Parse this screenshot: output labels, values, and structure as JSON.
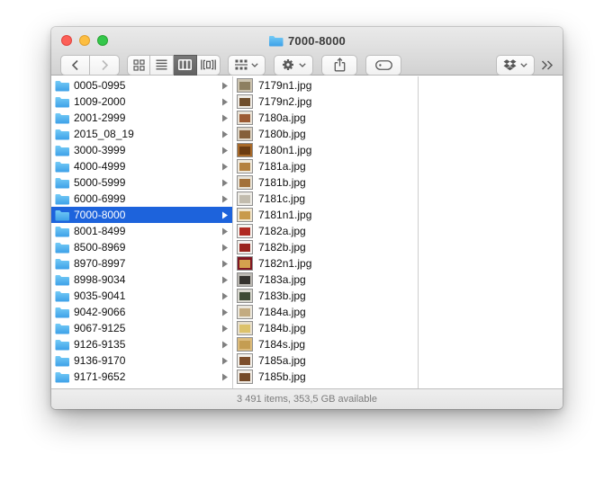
{
  "window": {
    "title": "7000-8000",
    "traffic_lights": [
      "close",
      "minimize",
      "zoom"
    ]
  },
  "toolbar": {
    "view_mode_selected": "column",
    "icons": {
      "back": "chevron-left-icon",
      "forward": "chevron-right-icon",
      "icon_view": "grid-icon",
      "list_view": "list-lines-icon",
      "column_view": "columns-icon",
      "cover_flow": "coverflow-icon",
      "arrange": "arrange-grid-icon",
      "action": "gear-icon",
      "share": "share-icon",
      "tags": "tag-icon",
      "dropbox": "dropbox-icon",
      "overflow": "double-chevron-right-icon"
    }
  },
  "columns": {
    "folders": {
      "selected_index": 8,
      "items": [
        {
          "name": "0005-0995",
          "selected": false
        },
        {
          "name": "1009-2000",
          "selected": false
        },
        {
          "name": "2001-2999",
          "selected": false
        },
        {
          "name": "2015_08_19",
          "selected": false
        },
        {
          "name": "3000-3999",
          "selected": false
        },
        {
          "name": "4000-4999",
          "selected": false
        },
        {
          "name": "5000-5999",
          "selected": false
        },
        {
          "name": "6000-6999",
          "selected": false
        },
        {
          "name": "7000-8000",
          "selected": true
        },
        {
          "name": "8001-8499",
          "selected": false
        },
        {
          "name": "8500-8969",
          "selected": false
        },
        {
          "name": "8970-8997",
          "selected": false
        },
        {
          "name": "8998-9034",
          "selected": false
        },
        {
          "name": "9035-9041",
          "selected": false
        },
        {
          "name": "9042-9066",
          "selected": false
        },
        {
          "name": "9067-9125",
          "selected": false
        },
        {
          "name": "9126-9135",
          "selected": false
        },
        {
          "name": "9136-9170",
          "selected": false
        },
        {
          "name": "9171-9652",
          "selected": false
        }
      ]
    },
    "files": {
      "items": [
        {
          "name": "7179n1.jpg",
          "c1": "#cdc5b2",
          "c2": "#8d7f60"
        },
        {
          "name": "7179n2.jpg",
          "c1": "#efece6",
          "c2": "#6f4e2c"
        },
        {
          "name": "7180a.jpg",
          "c1": "#e9e2d6",
          "c2": "#9c5a32"
        },
        {
          "name": "7180b.jpg",
          "c1": "#ded6c8",
          "c2": "#85603a"
        },
        {
          "name": "7180n1.jpg",
          "c1": "#a86a2a",
          "c2": "#6b3c12"
        },
        {
          "name": "7181a.jpg",
          "c1": "#efe9dd",
          "c2": "#b4813f"
        },
        {
          "name": "7181b.jpg",
          "c1": "#e9e4d9",
          "c2": "#a3713a"
        },
        {
          "name": "7181c.jpg",
          "c1": "#edebe5",
          "c2": "#c2bcae"
        },
        {
          "name": "7181n1.jpg",
          "c1": "#f0e6d0",
          "c2": "#c89a4b"
        },
        {
          "name": "7182a.jpg",
          "c1": "#f4f2ee",
          "c2": "#b02a22"
        },
        {
          "name": "7182b.jpg",
          "c1": "#f1efeb",
          "c2": "#99231c"
        },
        {
          "name": "7182n1.jpg",
          "c1": "#801723",
          "c2": "#d4a24e"
        },
        {
          "name": "7183a.jpg",
          "c1": "#bbb8b2",
          "c2": "#34322e"
        },
        {
          "name": "7183b.jpg",
          "c1": "#d9d8d0",
          "c2": "#3d4a34"
        },
        {
          "name": "7184a.jpg",
          "c1": "#ebe7dd",
          "c2": "#c3ab80"
        },
        {
          "name": "7184b.jpg",
          "c1": "#e7dfcd",
          "c2": "#dcc26b"
        },
        {
          "name": "7184s.jpg",
          "c1": "#dcbc7e",
          "c2": "#c49d52"
        },
        {
          "name": "7185a.jpg",
          "c1": "#f3f0ea",
          "c2": "#7d4e2b"
        },
        {
          "name": "7185b.jpg",
          "c1": "#efeae3",
          "c2": "#744a28"
        }
      ]
    }
  },
  "status_bar": {
    "text": "3 491 items, 353,5 GB available"
  },
  "colors": {
    "selection_blue": "#1d63dc",
    "folder_blue_top": "#74cbf6",
    "folder_blue_bottom": "#3da0e8",
    "toolbar_glyph": "#5a5a5a",
    "disabled_glyph": "#b9b9b9",
    "status_text": "#7c7c7c"
  }
}
